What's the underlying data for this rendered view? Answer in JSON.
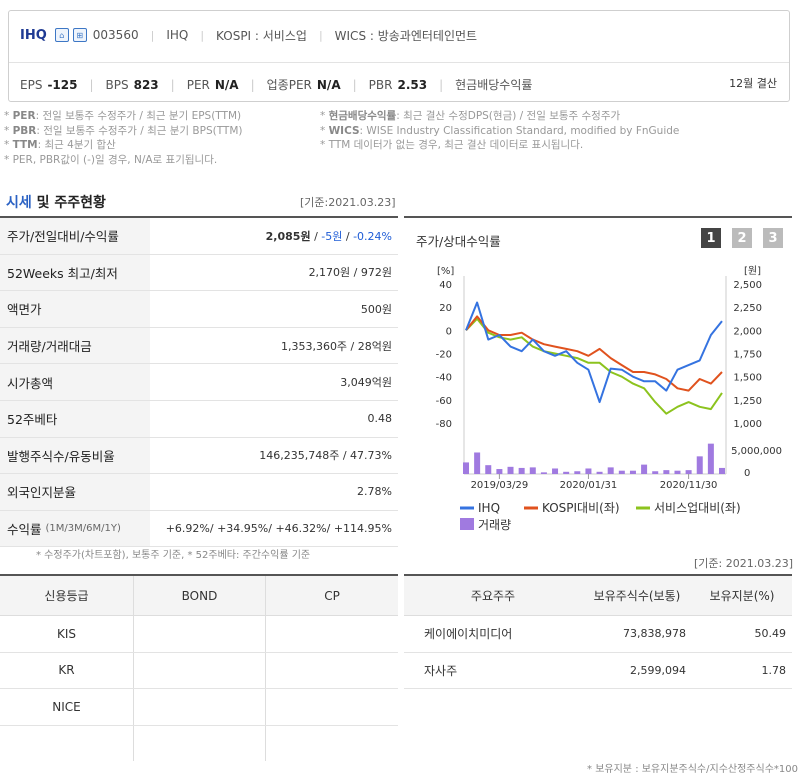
{
  "header": {
    "ticker": "IHQ",
    "icon1": "building-icon",
    "icon2": "grid-icon",
    "code": "003560",
    "name": "IHQ",
    "market": "KOSPI : 서비스업",
    "wics": "WICS : 방송과엔터테인먼트",
    "eps_label": "EPS",
    "eps_value": "-125",
    "bps_label": "BPS",
    "bps_value": "823",
    "per_label": "PER",
    "per_value": "N/A",
    "iper_label": "업종PER",
    "iper_value": "N/A",
    "pbr_label": "PBR",
    "pbr_value": "2.53",
    "div_label": "현금배당수익률",
    "settle": "12월 결산"
  },
  "notes": {
    "l1a": "PER",
    "l1b": ": 전일 보통주 수정주가 / 최근 분기 EPS(TTM)",
    "l2a": "PBR",
    "l2b": ": 전일 보통주 수정주가 / 최근 분기 BPS(TTM)",
    "l3a": "TTM",
    "l3b": ": 최근 4분기 합산",
    "l4": "* PER, PBR값이 (-)일 경우, N/A로 표기됩니다.",
    "r1a": "현금배당수익률",
    "r1b": ": 최근 결산 수정DPS(현금) / 전일 보통주 수정주가",
    "r2a": "WICS",
    "r2b": ": WISE Industry Classification Standard, modified by FnGuide",
    "r3": "* TTM 데이터가 없는 경우, 최근 결산 데이터로 표시됩니다."
  },
  "market_section": {
    "title_blue": "시세",
    "title_rest": " 및 주주현황",
    "date": "[기준:2021.03.23]",
    "rows": [
      {
        "label": "주가/전일대비/수익률"
      },
      {
        "label": "52Weeks 최고/최저",
        "value": "2,170원 / 972원"
      },
      {
        "label": "액면가",
        "value": "500원"
      },
      {
        "label": "거래량/거래대금",
        "value": "1,353,360주 / 28억원"
      },
      {
        "label": "시가총액",
        "value": "3,049억원"
      },
      {
        "label": "52주베타",
        "value": "0.48"
      },
      {
        "label": "발행주식수/유동비율",
        "value": "146,235,748주 / 47.73%"
      },
      {
        "label": "외국인지분율",
        "value": "2.78%"
      },
      {
        "label": "수익률",
        "sub": "(1M/3M/6M/1Y)"
      }
    ],
    "price": "2,085원",
    "price_sep1": " / ",
    "change": "-5원",
    "price_sep2": " / ",
    "change_pct": "-0.24%",
    "returns": [
      "+6.92%",
      "+34.95%",
      "+46.32%",
      "+114.95%"
    ],
    "note": "* 수정주가(차트포함), 보통주 기준, * 52주베타: 주간수익률 기준"
  },
  "chart_panel": {
    "title": "주가/상대수익률",
    "btn1": "1",
    "btn2": "2",
    "btn3": "3"
  },
  "chart_data": {
    "type": "line",
    "x_ticks": [
      "2019/03/29",
      "2020/01/31",
      "2020/11/30"
    ],
    "left_unit": "[%]",
    "right_unit": "[원]",
    "left_ticks": [
      40,
      20,
      0,
      -20,
      -40,
      -60,
      -80
    ],
    "right_ticks": [
      "2,500",
      "2,250",
      "2,000",
      "1,750",
      "1,500",
      "1,250",
      "1,000"
    ],
    "volume_ticks": [
      "5,000,000",
      "0"
    ],
    "ylim_left": [
      -80,
      40
    ],
    "ylim_right": [
      1000,
      2500
    ],
    "colors": {
      "ihq": "#3573e0",
      "kospi": "#e0521e",
      "service": "#8cc31e",
      "volume": "#a07ae0"
    },
    "series": [
      {
        "name": "IHQ",
        "values": [
          0,
          24,
          -8,
          -4,
          -14,
          -18,
          -8,
          -18,
          -22,
          -18,
          -28,
          -34,
          -62,
          -33,
          -34,
          -40,
          -44,
          -44,
          -52,
          -34,
          -30,
          -26,
          -4,
          8
        ]
      },
      {
        "name": "KOSPI대비(좌)",
        "values": [
          0,
          12,
          0,
          -4,
          -4,
          -2,
          -8,
          -12,
          -14,
          -16,
          -18,
          -22,
          -16,
          -24,
          -30,
          -36,
          -36,
          -38,
          -42,
          -50,
          -52,
          -42,
          -46,
          -36
        ]
      },
      {
        "name": "서비스업대비(좌)",
        "values": [
          0,
          10,
          -2,
          -6,
          -8,
          -6,
          -14,
          -18,
          -20,
          -22,
          -24,
          -28,
          -28,
          -36,
          -40,
          -46,
          -50,
          -62,
          -72,
          -66,
          -62,
          -66,
          -68,
          -54
        ]
      },
      {
        "name": "거래량",
        "values": [
          2.1,
          3.9,
          1.6,
          0.9,
          1.3,
          1.1,
          1.2,
          0.3,
          1.0,
          0.4,
          0.5,
          1.0,
          0.4,
          1.2,
          0.6,
          0.6,
          1.7,
          0.5,
          0.7,
          0.6,
          0.7,
          3.2,
          5.5,
          1.1
        ]
      }
    ]
  },
  "holders": {
    "date": "[기준: 2021.03.23]",
    "headers": [
      "주요주주",
      "보유주식수(보통)",
      "보유지분(%)"
    ],
    "rows": [
      {
        "name": "케이에이치미디어",
        "shares": "73,838,978",
        "pct": "50.49"
      },
      {
        "name": "자사주",
        "shares": "2,599,094",
        "pct": "1.78"
      }
    ],
    "note": "* 보유지분 : 보유지분주식수/지수산정주식수*100"
  },
  "credit": {
    "headers": [
      "신용등급",
      "BOND",
      "CP"
    ],
    "rows": [
      "KIS",
      "KR",
      "NICE"
    ]
  }
}
